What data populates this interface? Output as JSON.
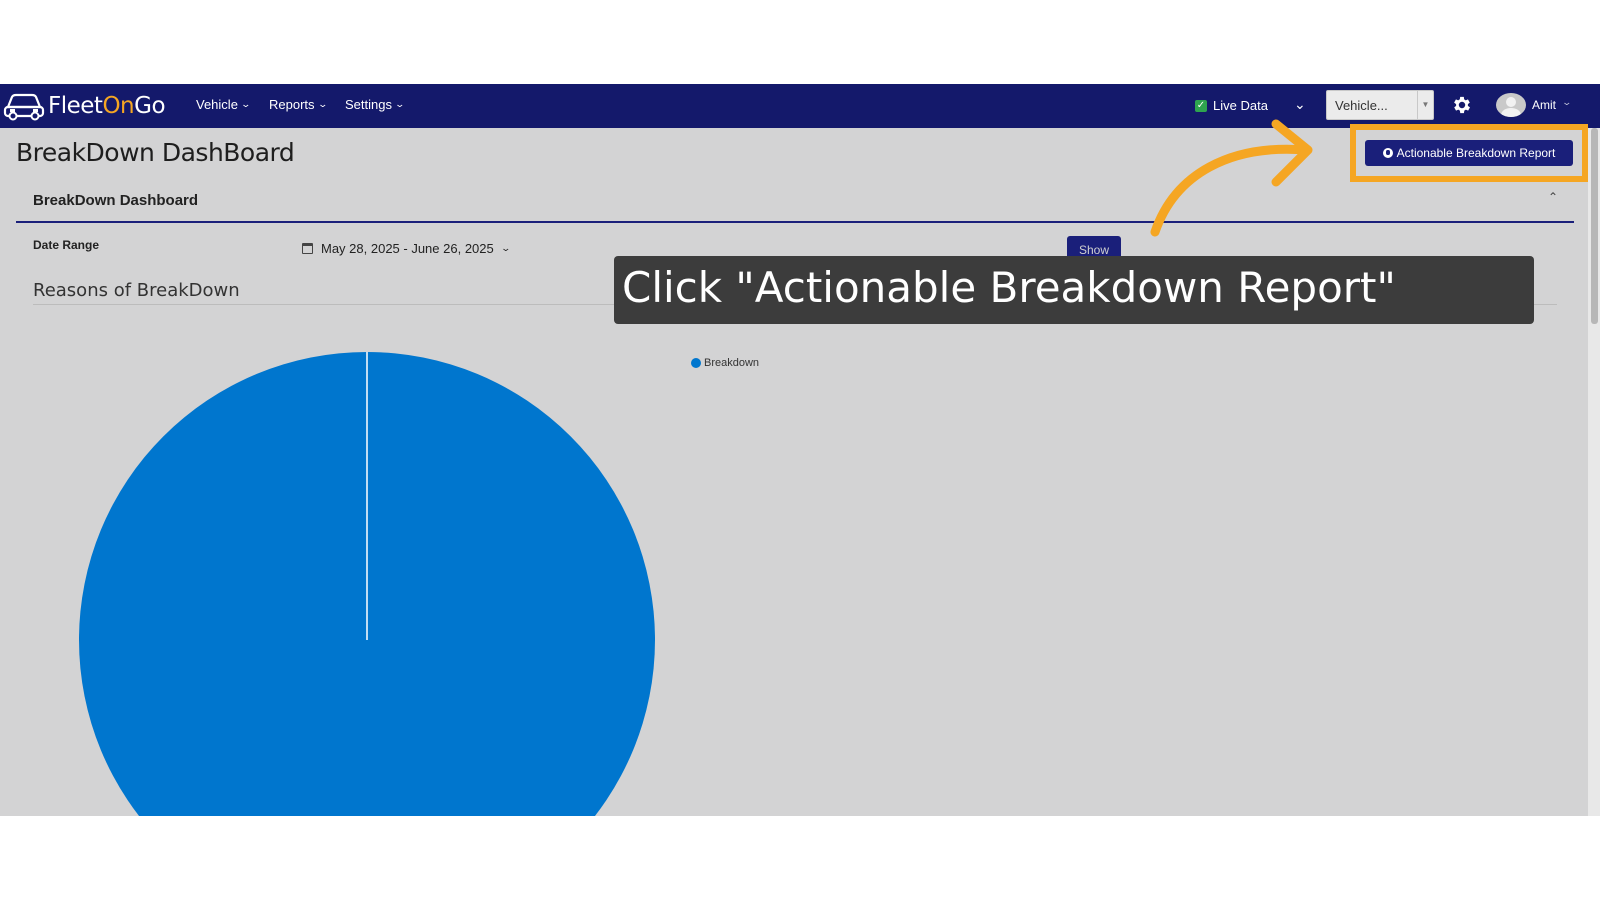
{
  "app": {
    "logo_text_a": "Fleet",
    "logo_text_b": "On",
    "logo_text_c": "Go",
    "logo_icon": "car-icon",
    "brand_accent": "#f5a623",
    "navbar_color": "#14196b"
  },
  "nav": {
    "items": [
      {
        "label": "Vehicle"
      },
      {
        "label": "Reports"
      },
      {
        "label": "Settings"
      }
    ],
    "live_data_label": "Live Data",
    "live_data_checked": true,
    "vehicle_select_value": "Vehicle...",
    "user_name": "Amit"
  },
  "page": {
    "title": "BreakDown DashBoard",
    "action_button_label": "Actionable Breakdown Report",
    "card_title": "BreakDown Dashboard",
    "date_range_label": "Date Range",
    "date_range_value": "May 28, 2025 - June 26, 2025",
    "show_button_label": "Show",
    "section_title": "Reasons of BreakDown"
  },
  "overlay": {
    "instruction": "Click \"Actionable Breakdown Report\"",
    "highlight_color": "#f5a623"
  },
  "chart_data": {
    "type": "pie",
    "categories": [
      "Breakdown"
    ],
    "values": [
      100
    ],
    "colors": [
      "#0076ce"
    ],
    "legend_placement": "top-right"
  }
}
